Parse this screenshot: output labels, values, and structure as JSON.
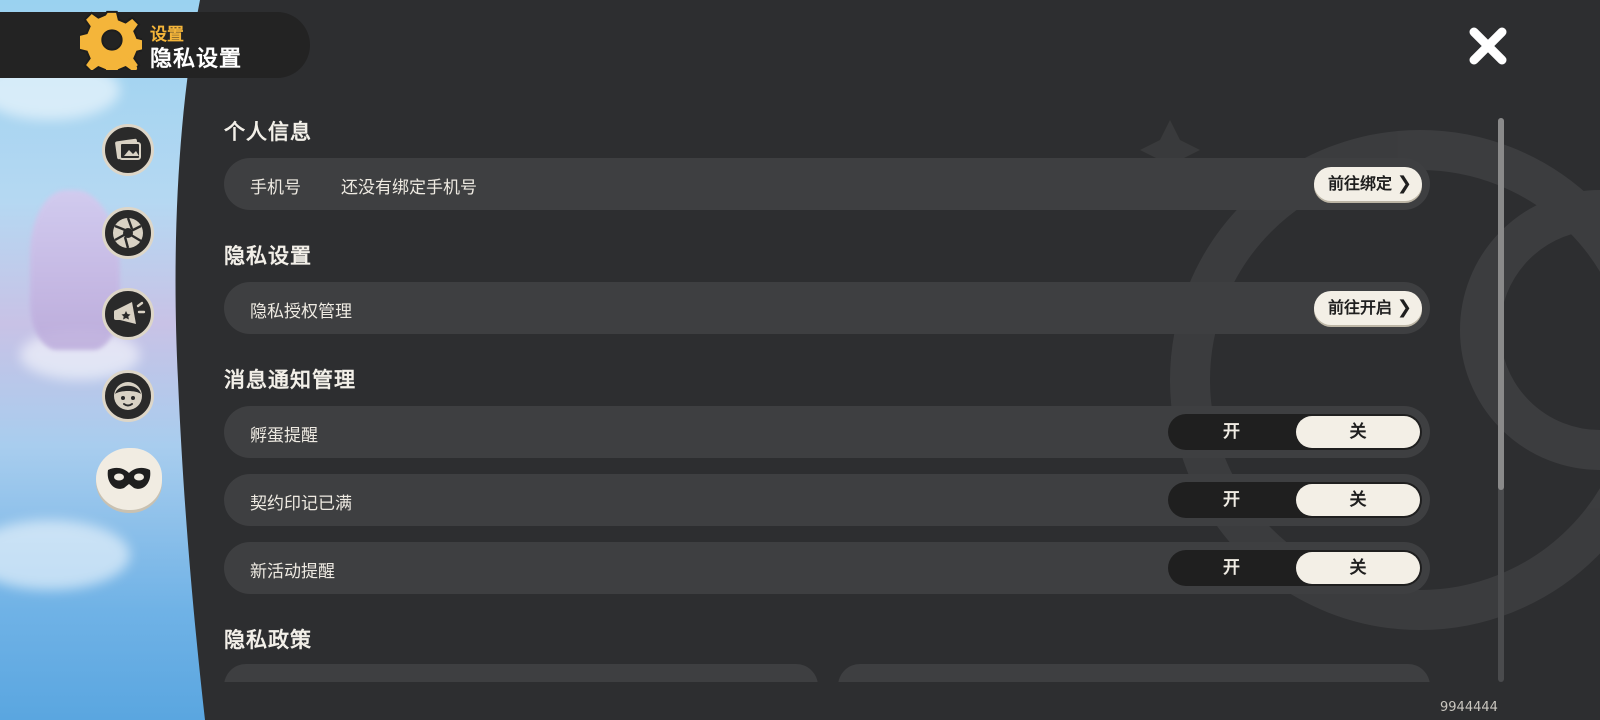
{
  "header": {
    "subtitle": "设置",
    "title": "隐私设置"
  },
  "side_nav": [
    {
      "id": "gallery",
      "icon": "photo-frame-icon"
    },
    {
      "id": "camera",
      "icon": "aperture-icon"
    },
    {
      "id": "announcement",
      "icon": "megaphone-icon"
    },
    {
      "id": "profile",
      "icon": "character-face-icon"
    },
    {
      "id": "privacy",
      "icon": "mask-icon",
      "active": true
    }
  ],
  "sections": {
    "personal_info": {
      "title": "个人信息",
      "phone_label": "手机号",
      "phone_value": "还没有绑定手机号",
      "bind_button": "前往绑定"
    },
    "privacy_settings": {
      "title": "隐私设置",
      "auth_label": "隐私授权管理",
      "open_button": "前往开启"
    },
    "notifications": {
      "title": "消息通知管理",
      "on_label": "开",
      "off_label": "关",
      "items": [
        {
          "label": "孵蛋提醒",
          "state": "off"
        },
        {
          "label": "契约印记已满",
          "state": "off"
        },
        {
          "label": "新活动提醒",
          "state": "off"
        }
      ]
    },
    "privacy_policy": {
      "title": "隐私政策"
    }
  },
  "uid": "9944444",
  "colors": {
    "background": "#2d2e30",
    "row": "#3e3f41",
    "accent_gear": "#f4b53a",
    "button_light": "#f3efe6",
    "toggle_dark": "#1f1f1f"
  }
}
